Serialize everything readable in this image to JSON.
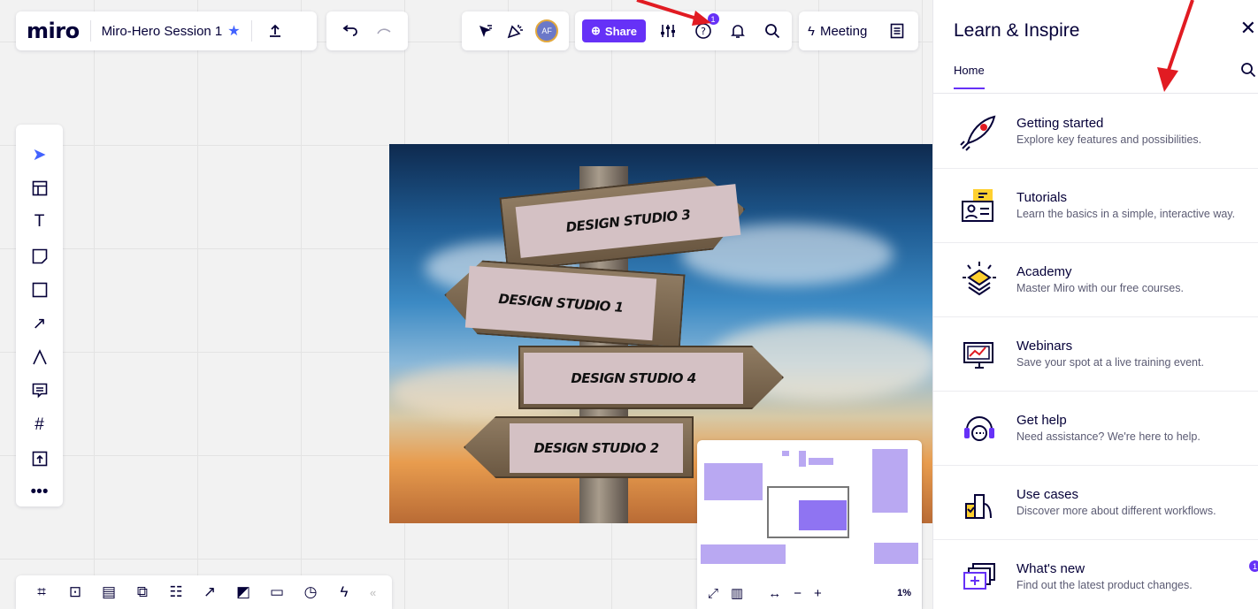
{
  "board": {
    "logo": "miro",
    "name": "Miro-Hero Session 1",
    "share_label": "Share",
    "help_badge": "1",
    "avatar_initials": "AF",
    "meeting_label": "Meeting"
  },
  "canvas": {
    "signs": [
      "DESIGN STUDIO 3",
      "DESIGN STUDIO 1",
      "DESIGN STUDIO 4",
      "DESIGN STUDIO 2"
    ],
    "zoom": "1%"
  },
  "learn_panel": {
    "title": "Learn & Inspire",
    "tab": "Home",
    "items": [
      {
        "title": "Getting started",
        "desc": "Explore key features and possibilities."
      },
      {
        "title": "Tutorials",
        "desc": "Learn the basics in a simple, interactive way."
      },
      {
        "title": "Academy",
        "desc": "Master Miro with our free courses."
      },
      {
        "title": "Webinars",
        "desc": "Save your spot at a live training event."
      },
      {
        "title": "Get help",
        "desc": "Need assistance? We're here to help."
      },
      {
        "title": "Use cases",
        "desc": "Discover more about different workflows."
      },
      {
        "title": "What's new",
        "desc": "Find out the latest product changes.",
        "badge": "1"
      }
    ]
  },
  "colors": {
    "accent": "#6631f7",
    "annotation_arrow": "#e11b22"
  }
}
